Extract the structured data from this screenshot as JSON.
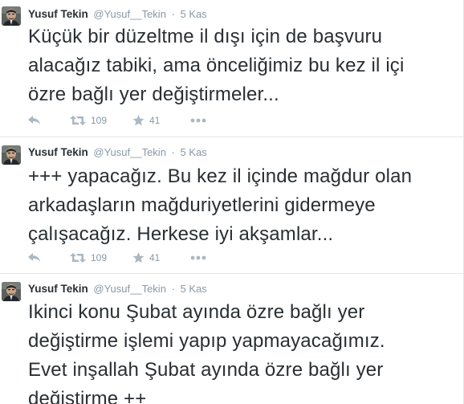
{
  "tweets": [
    {
      "fullname": "Yusuf Tekin",
      "username": "@Yusuf__Tekin",
      "separator": "·",
      "time": "5 Kas",
      "text": "Küçük bir düzeltme il dışı için de başvuru\nalacağız tabiki, ama önceliğimiz bu kez il içi\nözre bağlı yer değiştirmeler...",
      "retweets": "109",
      "favorites": "41"
    },
    {
      "fullname": "Yusuf Tekin",
      "username": "@Yusuf__Tekin",
      "separator": "·",
      "time": "5 Kas",
      "text": "+++ yapacağız. Bu kez il içinde mağdur olan\narkadaşların mağduriyetlerini gidermeye\nçalışacağız. Herkese iyi akşamlar...",
      "retweets": "109",
      "favorites": "41"
    },
    {
      "fullname": "Yusuf Tekin",
      "username": "@Yusuf__Tekin",
      "separator": "·",
      "time": "5 Kas",
      "text": "Ikinci konu Şubat ayında özre bağlı yer\ndeğiştirme işlemi yapıp yapmayacağımız.\nEvet inşallah Şubat ayında özre bağlı yer\ndeğiştirme ++"
    }
  ],
  "icons": {
    "reply": "reply-icon",
    "retweet": "retweet-icon",
    "favorite": "star-icon",
    "more": "more-icon"
  },
  "colors": {
    "text": "#292f33",
    "muted": "#8899a6",
    "icon": "#aab8c2",
    "divider": "#e1e8ed"
  }
}
